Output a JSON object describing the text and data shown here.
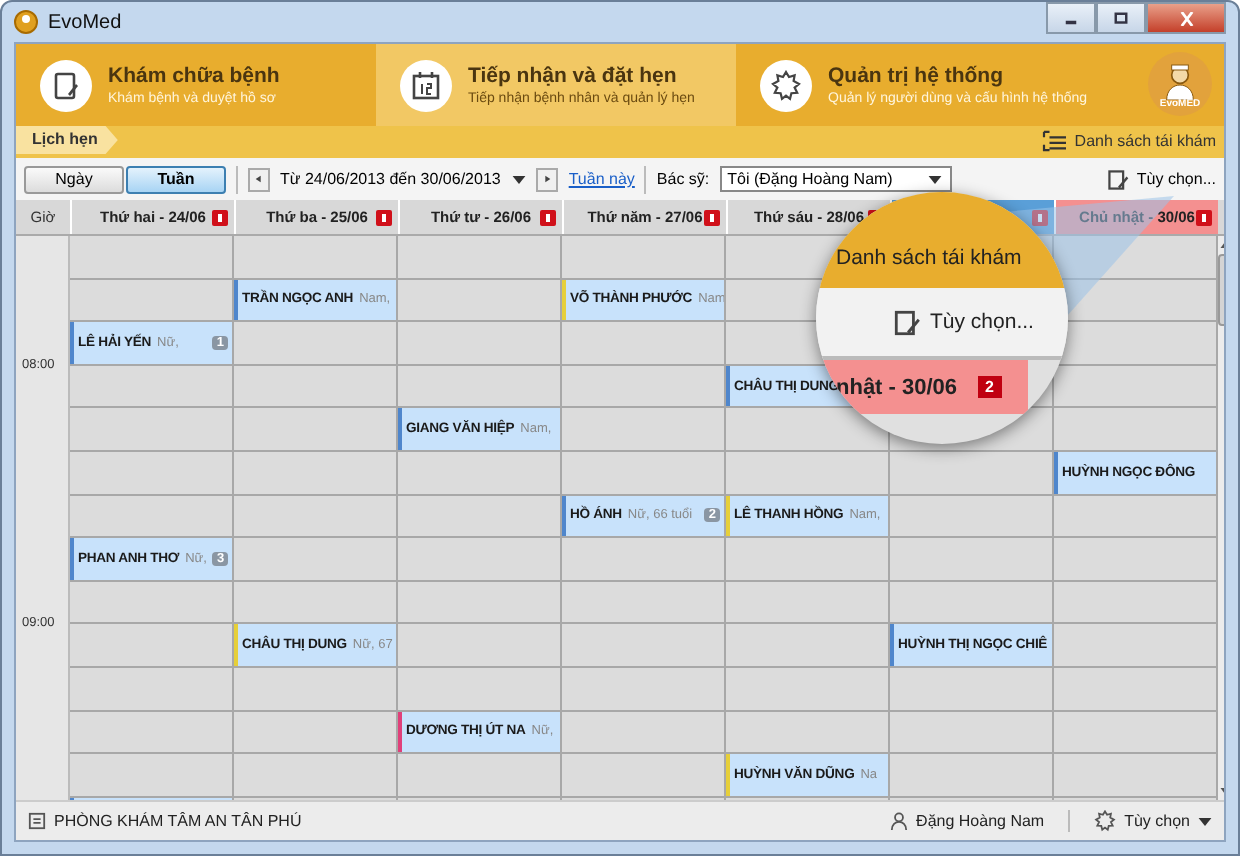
{
  "window": {
    "title": "EvoMed"
  },
  "nav_tabs": [
    {
      "title": "Khám chữa bệnh",
      "subtitle": "Khám bệnh và duyệt hồ sơ",
      "kind": "notepad",
      "selected": false
    },
    {
      "title": "Tiếp nhận và đặt hẹn",
      "subtitle": "Tiếp nhận bệnh nhân và quản lý hẹn",
      "kind": "calendar",
      "selected": true
    },
    {
      "title": "Quản trị hệ thống",
      "subtitle": "Quản lý người dùng và cấu hình hệ thống",
      "kind": "gear",
      "selected": false
    }
  ],
  "logo": {
    "text": "EvoMED"
  },
  "breadcrumb": {
    "label": "Lịch hẹn",
    "action": "Danh sách tái khám"
  },
  "toolbar": {
    "views": [
      {
        "label": "Ngày",
        "selected": false
      },
      {
        "label": "Tuần",
        "selected": true
      }
    ],
    "date_range": "Từ 24/06/2013 đến 30/06/2013",
    "this_week_link": "Tuần này",
    "doctor_label": "Bác sỹ:",
    "doctor": "Tôi (Đặng Hoàng Nam)",
    "options": "Tùy chọn..."
  },
  "calendar": {
    "time_heading": "Giờ",
    "days": [
      {
        "label": "Thứ hai - 24/06",
        "kind": "normal"
      },
      {
        "label": "Thứ ba - 25/06",
        "kind": "normal"
      },
      {
        "label": "Thứ tư - 26/06",
        "kind": "normal"
      },
      {
        "label": "Thứ năm - 27/06",
        "kind": "normal"
      },
      {
        "label": "Thứ sáu - 28/06",
        "kind": "normal"
      },
      {
        "kind": "today"
      },
      {
        "label": "Chủ nhật - 30/06",
        "kind": "sunday"
      }
    ],
    "rows": [
      {
        "cells": [
          null,
          null,
          null,
          null,
          null,
          null,
          null
        ]
      },
      {
        "cells": [
          null,
          {
            "name": "TRẦN NGỌC ANH",
            "details": "Nam,",
            "color": "#4f86cc"
          },
          null,
          {
            "name": "VÕ THÀNH PHƯỚC",
            "details": "Nam",
            "color": "#e6cf3a"
          },
          null,
          null,
          null
        ]
      },
      {
        "cells": [
          {
            "name": "LÊ HẢI YẾN",
            "details": "Nữ,",
            "badge": "1",
            "color": "#4f86cc"
          },
          null,
          null,
          null,
          null,
          null,
          null
        ]
      },
      {
        "hour": "08:00",
        "cells": [
          null,
          null,
          null,
          null,
          {
            "name": "CHÂU THỊ DUNG",
            "color": "#4f86cc"
          },
          null,
          null
        ]
      },
      {
        "cells": [
          null,
          null,
          {
            "name": "GIANG VĂN HIỆP",
            "details": "Nam,",
            "color": "#4f86cc"
          },
          null,
          null,
          null,
          null
        ]
      },
      {
        "cells": [
          null,
          null,
          null,
          null,
          null,
          null,
          {
            "name": "HUỲNH NGỌC ĐÔNG",
            "color": "#4f86cc"
          }
        ]
      },
      {
        "cells": [
          null,
          null,
          null,
          {
            "name": "HỒ ÁNH",
            "details": "Nữ, 66 tuổi",
            "badge": "2",
            "color": "#4f86cc"
          },
          {
            "name": "LÊ THANH HỒNG",
            "details": "Nam,",
            "color": "#e6cf3a"
          },
          null,
          null
        ]
      },
      {
        "cells": [
          {
            "name": "PHAN ANH THƠ",
            "details": "Nữ,",
            "badge": "3",
            "color": "#4f86cc"
          },
          null,
          null,
          null,
          null,
          null,
          null
        ]
      },
      {
        "cells": [
          null,
          null,
          null,
          null,
          null,
          null,
          null
        ]
      },
      {
        "hour": "09:00",
        "cells": [
          null,
          {
            "name": "CHÂU THỊ DUNG",
            "details": "Nữ, 67",
            "color": "#e6cf3a"
          },
          null,
          null,
          null,
          {
            "name": "HUỲNH THỊ NGỌC CHIÊ",
            "color": "#4f86cc"
          },
          null
        ]
      },
      {
        "cells": [
          null,
          null,
          null,
          null,
          null,
          null,
          null
        ]
      },
      {
        "cells": [
          null,
          null,
          {
            "name": "DƯƠNG THỊ ÚT NA",
            "details": "Nữ,",
            "color": "#e0407a"
          },
          null,
          null,
          null,
          null
        ]
      },
      {
        "cells": [
          null,
          null,
          null,
          null,
          {
            "name": "HUỲNH VĂN DŨNG",
            "details": "Na",
            "color": "#e6cf3a"
          },
          null,
          null
        ]
      },
      {
        "cells": [
          {
            "color": "#4f86cc"
          },
          null,
          null,
          null,
          null,
          null,
          null
        ]
      }
    ]
  },
  "magnifier": {
    "action": "Danh sách tái khám",
    "options": "Tùy chọn...",
    "day_label": "nhật - 30/06",
    "day_badge": "2"
  },
  "status_bar": {
    "clinic": "PHÒNG KHÁM TÂM AN TÂN PHÚ",
    "user": "Đặng Hoàng Nam",
    "options": "Tùy chọn"
  }
}
